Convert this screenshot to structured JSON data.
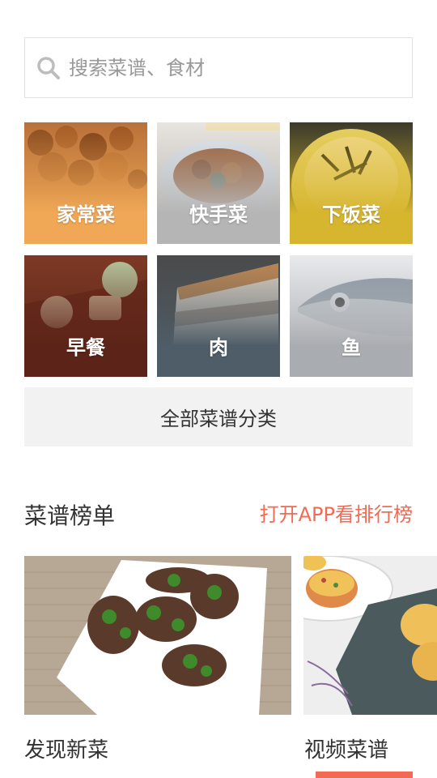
{
  "search": {
    "placeholder": "搜索菜谱、食材",
    "icon": "search-icon"
  },
  "categories": [
    {
      "label": "家常菜",
      "color": "#f0a856"
    },
    {
      "label": "快手菜",
      "color": "#b5b5b5"
    },
    {
      "label": "下饭菜",
      "color": "#d6b52f"
    },
    {
      "label": "早餐",
      "color": "#5c2418"
    },
    {
      "label": "肉",
      "color": "#4f5d68"
    },
    {
      "label": "鱼",
      "color": "#a9acb0"
    }
  ],
  "all_categories_button": "全部菜谱分类",
  "ranking": {
    "title": "菜谱榜单",
    "app_link": "打开APP看排行榜"
  },
  "cards": [
    {
      "title": "发现新菜"
    },
    {
      "title": "视频菜谱"
    }
  ],
  "colors": {
    "accent": "#f26a53"
  }
}
